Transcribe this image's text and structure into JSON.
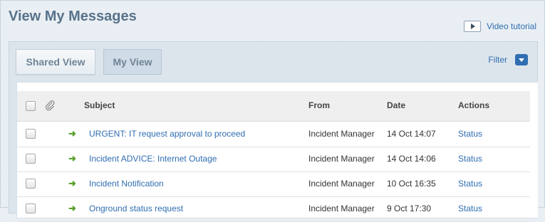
{
  "header": {
    "title": "View My Messages",
    "video_tutorial_label": "Video tutorial"
  },
  "tabs": {
    "shared": "Shared View",
    "my": "My View",
    "active": "my"
  },
  "filter": {
    "label": "Filter"
  },
  "table": {
    "headers": {
      "subject": "Subject",
      "from": "From",
      "date": "Date",
      "actions": "Actions"
    },
    "rows": [
      {
        "subject": "URGENT: IT request approval to proceed",
        "from": "Incident Manager",
        "date": "14 Oct 14:07",
        "action": "Status"
      },
      {
        "subject": "Incident ADVICE: Internet Outage",
        "from": "Incident Manager",
        "date": "14 Oct 14:06",
        "action": "Status"
      },
      {
        "subject": "Incident Notification",
        "from": "Incident Manager",
        "date": "10 Oct 16:35",
        "action": "Status"
      },
      {
        "subject": "Onground status request",
        "from": "Incident Manager",
        "date": "9 Oct 17:30",
        "action": "Status"
      }
    ]
  },
  "colors": {
    "title": "#58728a",
    "link": "#2f6eb1",
    "arrow": "#5aa02c",
    "panel": "#dde5ec"
  },
  "icons": {
    "play": "play-icon",
    "filter": "chevron-down-icon",
    "attachment": "paperclip-icon",
    "row": "arrow-right-icon"
  }
}
